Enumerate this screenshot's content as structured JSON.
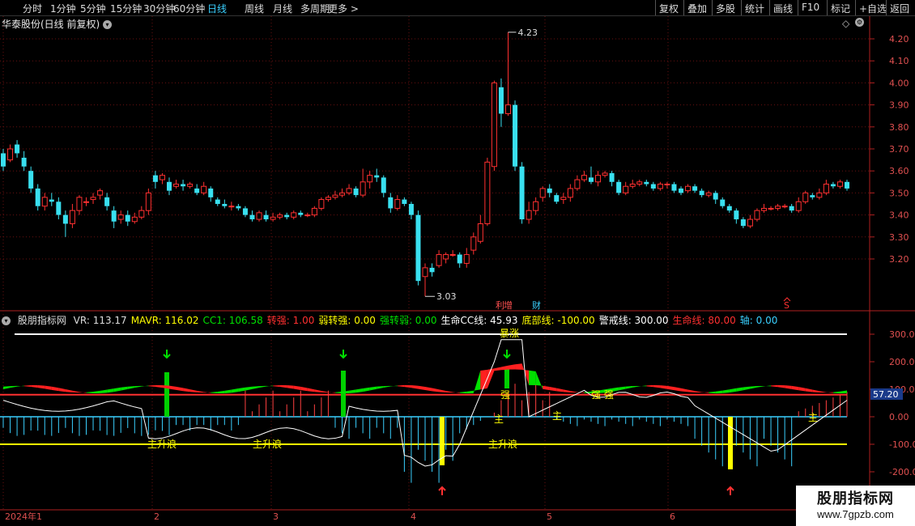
{
  "toolbar": {
    "periods": [
      "分时",
      "1分钟",
      "5分钟",
      "15分钟",
      "30分钟",
      "60分钟",
      "日线",
      "周线",
      "月线",
      "多周期",
      "更多"
    ],
    "active_period": "日线",
    "right_buttons": [
      "复权",
      "叠加",
      "多股",
      "统计",
      "画线",
      "F10",
      "标记",
      "+自选",
      "返回"
    ]
  },
  "title": {
    "stock": "华泰股份(日线 前复权)"
  },
  "indicator": {
    "name": "股朋指标网",
    "values": [
      {
        "label": "VR: 113.17",
        "color": "#dddddd"
      },
      {
        "label": "MAVR: 116.02",
        "color": "#ffff00"
      },
      {
        "label": "CC1: 106.58",
        "color": "#00e000"
      },
      {
        "label": "转强: 1.00",
        "color": "#ff3030"
      },
      {
        "label": "弱转强: 0.00",
        "color": "#ffff00"
      },
      {
        "label": "强转弱: 0.00",
        "color": "#00e000"
      },
      {
        "label": "生命CC线: 45.93",
        "color": "#ffffff"
      },
      {
        "label": "底部线: -100.00",
        "color": "#ffff00"
      },
      {
        "label": "警戒线: 300.00",
        "color": "#ffffff"
      },
      {
        "label": "生命线: 80.00",
        "color": "#ff3030"
      },
      {
        "label": "轴: 0.00",
        "color": "#3ad0ff"
      }
    ]
  },
  "price_axis": [
    "4.20",
    "4.10",
    "4.00",
    "3.90",
    "3.80",
    "3.70",
    "3.60",
    "3.50",
    "3.40",
    "3.30",
    "3.20"
  ],
  "ind_axis": [
    "300.00",
    "200.00",
    "100.00",
    "0.00",
    "-100.00",
    "-200.00"
  ],
  "ind_current": "57.20",
  "time_axis": [
    "2024年1",
    "2",
    "3",
    "4",
    "5",
    "6"
  ],
  "annotations": {
    "high": "4.23",
    "low": "3.03",
    "events": [
      "利",
      "增",
      "财"
    ],
    "s_mark": "S",
    "zhu": "主",
    "qiang": "强",
    "zhu_sheng": "主升浪",
    "zhu_sheng_2": "主升浪",
    "zhu_sheng_3": "主升浪",
    "bao_zhang": "暴涨",
    "qiang_pair": "强 强"
  },
  "watermark": {
    "line1": "股朋指标网",
    "line2": "www.7gpzb.com"
  },
  "colors": {
    "up": "#ff3030",
    "down": "#39e0f0",
    "bg": "#000000",
    "grid": "#6a1010"
  }
}
